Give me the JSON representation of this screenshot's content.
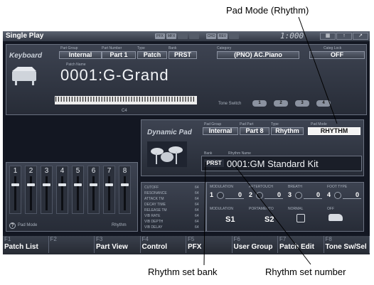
{
  "annotations": {
    "pad_mode": "Pad Mode (Rhythm)",
    "rhythm_set_bank": "Rhythm set bank",
    "rhythm_set_number": "Rhythm set number"
  },
  "header": {
    "title": "Single Play",
    "chips": [
      "PFX",
      "MFX",
      "",
      "",
      "CHO",
      "REV",
      ""
    ],
    "clock": "1:000",
    "icons": [
      "grid-icon",
      "up-icon",
      "exit-icon"
    ]
  },
  "keyboard": {
    "title": "Keyboard",
    "labels": {
      "part_group": "Part Group",
      "part_number": "Part Number",
      "type": "Type",
      "bank": "Bank",
      "category": "Category",
      "category_lock": "Categ Lock",
      "patch_name": "Patch Name",
      "tone_switch": "Tone Switch"
    },
    "values": {
      "part_group": "Internal",
      "part_number": "Part 1",
      "type": "Patch",
      "bank": "PRST",
      "category": "(PNO) AC.Piano",
      "category_lock": "OFF"
    },
    "patch": "0001:G-Grand",
    "tone_buttons": [
      "1",
      "2",
      "3",
      "4"
    ],
    "octave": "C4"
  },
  "dynamic_pad": {
    "title": "Dynamic Pad",
    "labels": {
      "pad_group": "Pad Group",
      "pad_part": "Pad Part",
      "type": "Type",
      "pad_mode": "Pad Mode",
      "bank": "Bank",
      "rhythm_name": "Rhythm Name"
    },
    "values": {
      "pad_group": "Internal",
      "pad_part": "Part 8",
      "type": "Rhythm",
      "pad_mode": "RHYTHM",
      "bank": "PRST"
    },
    "rhythm_set": "0001:GM Standard Kit"
  },
  "mixer": {
    "channels": [
      "1",
      "2",
      "3",
      "4",
      "5",
      "6",
      "7",
      "8"
    ],
    "levels": [
      0.8,
      0.8,
      0.8,
      0.8,
      0.8,
      0.8,
      0.8,
      0.8
    ],
    "pad_mode_label": "Pad Mode",
    "rhythm_label": "Rhythm",
    "help": "?"
  },
  "params": {
    "names": [
      "CUTOFF",
      "RESONANCE",
      "ATTACK TM",
      "DECAY TIME",
      "RELEASE TM",
      "VIB RATE",
      "VIB DEPTH",
      "VIB DELAY"
    ],
    "values": [
      "64",
      "64",
      "64",
      "64",
      "64",
      "64",
      "64",
      "64"
    ]
  },
  "controls": {
    "row1": [
      {
        "label": "MODULATION",
        "num": "1",
        "value": "0"
      },
      {
        "label": "AFTERTOUCH",
        "num": "2",
        "value": "0"
      },
      {
        "label": "BREATH",
        "num": "3",
        "value": "0"
      },
      {
        "label": "FOOT TYPE",
        "num": "4",
        "value": "0"
      }
    ],
    "row2": [
      {
        "label": "MODULATION",
        "value": "S1"
      },
      {
        "label": "PORTAMENTO",
        "value": "S2"
      },
      {
        "label": "NORMAL",
        "value": ""
      },
      {
        "label": "OFF",
        "value": ""
      }
    ]
  },
  "fkeys": [
    {
      "num": "F1",
      "label": "Patch List"
    },
    {
      "num": "F2",
      "label": ""
    },
    {
      "num": "F3",
      "label": "Part View"
    },
    {
      "num": "F4",
      "label": "Control"
    },
    {
      "num": "F5",
      "label": "PFX"
    },
    {
      "num": "F6",
      "label": "User Group"
    },
    {
      "num": "F7",
      "label": "Patch Edit"
    },
    {
      "num": "F8",
      "label": "Tone Sw/Sel"
    }
  ]
}
